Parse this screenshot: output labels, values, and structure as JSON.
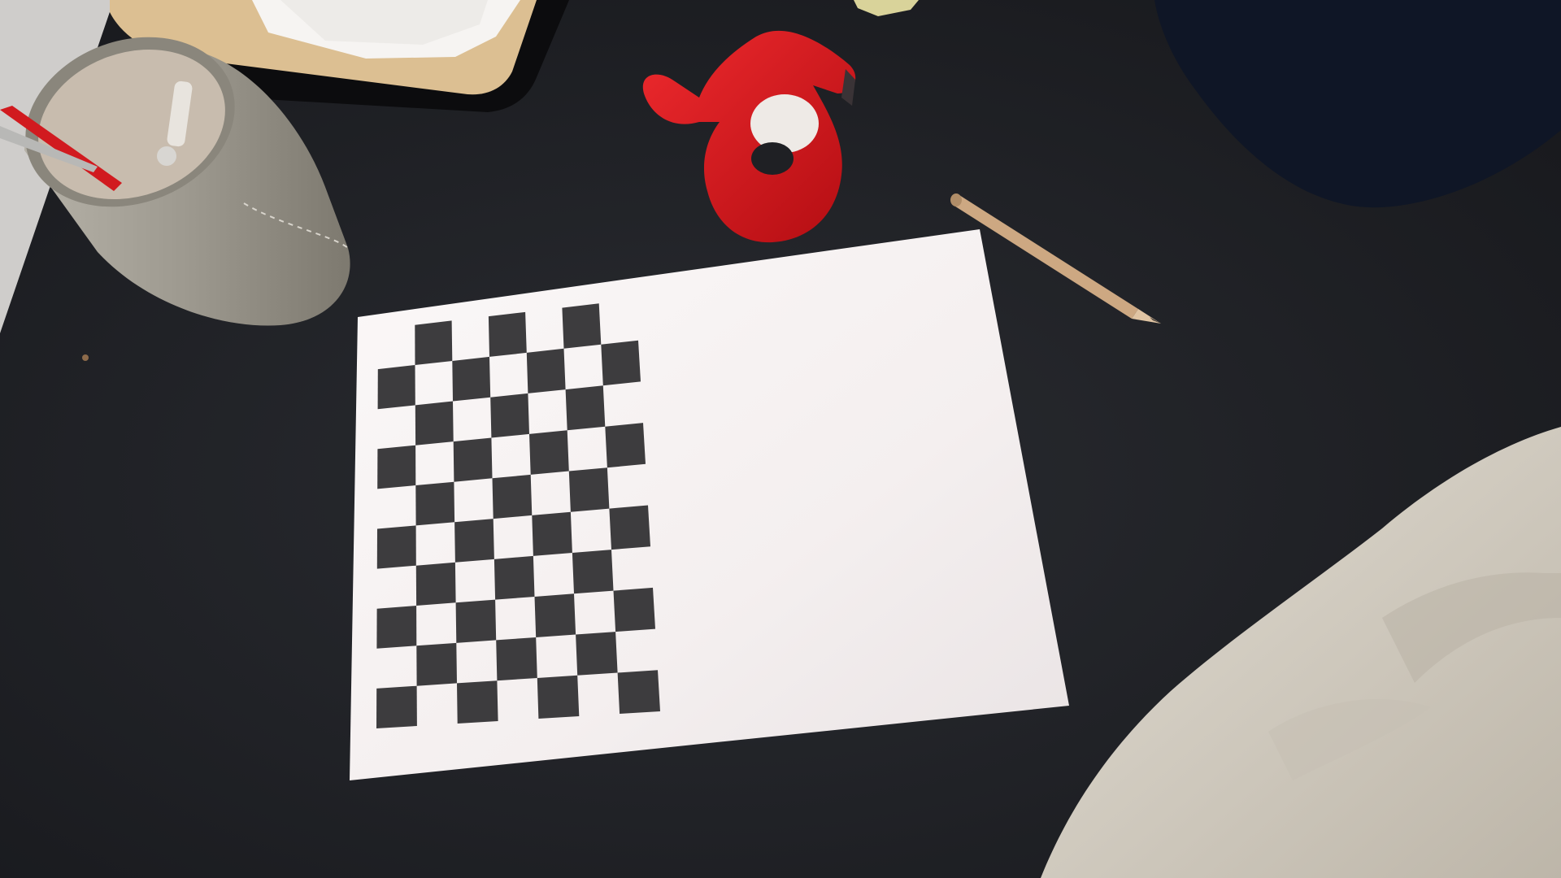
{
  "scene": {
    "kind": "photograph",
    "objects": [
      "desk-surface",
      "notebook-tray",
      "pen-holder",
      "tape-dispenser",
      "paper-sheet",
      "checkerboard-pattern",
      "pencil",
      "sweater-sleeve",
      "dark-bag"
    ]
  },
  "checkerboard": {
    "rows": 10,
    "cols": 7
  },
  "colors": {
    "desk": "#202227",
    "paper": "#f4f1f1",
    "checker_dark": "#3d3c3e",
    "tape_dispenser": "#d8141a",
    "pen_holder": "#9a968c",
    "tray_wood": "#dcbf92",
    "pencil_wood": "#cda882",
    "sweater": "#d6d0c5",
    "bag": "#0f1626"
  }
}
